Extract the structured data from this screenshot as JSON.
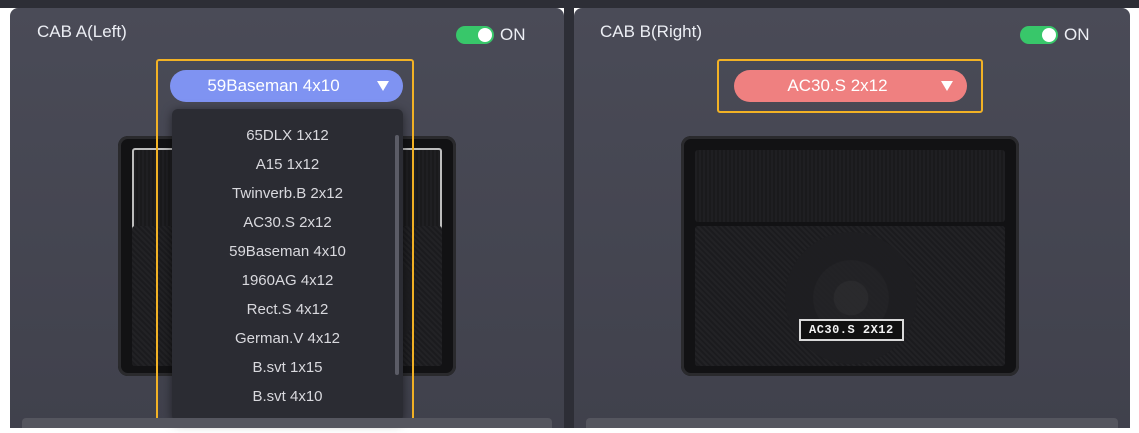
{
  "cab_a": {
    "title": "CAB A(Left)",
    "toggle_label": "ON",
    "selected": "59Baseman 4x10",
    "select_color": "#7f93f2",
    "options": [
      "65DLX 1x12",
      "A15 1x12",
      "Twinverb.B 2x12",
      "AC30.S 2x12",
      "59Baseman 4x10",
      "1960AG 4x12",
      "Rect.S 4x12",
      "German.V 4x12",
      "B.svt 1x15",
      "B.svt 4x10"
    ]
  },
  "cab_b": {
    "title": "CAB B(Right)",
    "toggle_label": "ON",
    "selected": "AC30.S 2x12",
    "select_color": "#ef8080",
    "badge": "AC30.S 2X12"
  },
  "colors": {
    "panel_bg": "#45464f",
    "toggle_on": "#38c76a",
    "highlight_frame": "#f2b225"
  }
}
